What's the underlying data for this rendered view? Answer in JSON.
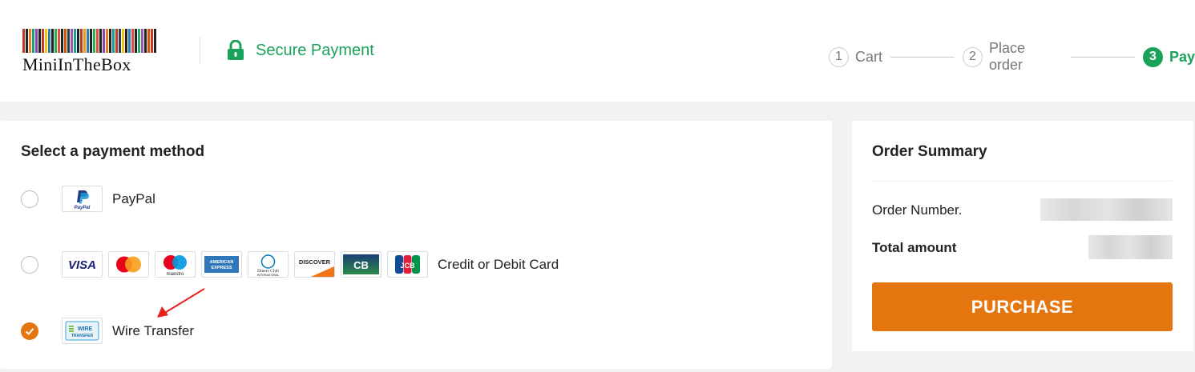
{
  "header": {
    "logo_text": "MiniInTheBox",
    "secure_label": "Secure Payment",
    "steps": [
      {
        "num": "1",
        "label": "Cart"
      },
      {
        "num": "2",
        "label": "Place order"
      },
      {
        "num": "3",
        "label": "Pay"
      }
    ],
    "active_step": 3
  },
  "payment": {
    "title": "Select a payment method",
    "options": [
      {
        "label": "PayPal",
        "selected": false,
        "logos": [
          "paypal-logo"
        ]
      },
      {
        "label": "Credit or Debit Card",
        "selected": false,
        "logos": [
          "visa-logo",
          "mastercard-logo",
          "maestro-logo",
          "amex-logo",
          "diners-club-logo",
          "discover-logo",
          "cb-logo",
          "jcb-logo"
        ]
      },
      {
        "label": "Wire Transfer",
        "selected": true,
        "logos": [
          "wire-transfer-logo"
        ]
      }
    ],
    "logo_text": {
      "paypal": "PayPal",
      "visa": "VISA",
      "maestro": "maestro",
      "amex_line1": "AMERICAN",
      "amex_line2": "EXPRESS",
      "diners_line1": "Diners Club",
      "diners_line2": "INTERNATIONAL",
      "discover": "DISCOVER",
      "cb": "CB",
      "jcb": "JCB",
      "wire_line1": "WIRE",
      "wire_line2": "TRANSFER"
    }
  },
  "summary": {
    "title": "Order Summary",
    "order_number_label": "Order Number.",
    "total_label": "Total amount",
    "purchase_label": "PURCHASE"
  },
  "colors": {
    "accent_green": "#1aa25a",
    "accent_orange": "#e5760f",
    "annotation_arrow": "#e8201a"
  }
}
